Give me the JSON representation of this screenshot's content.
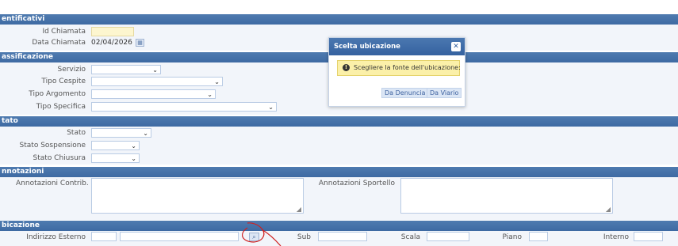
{
  "sections": {
    "identificativi": "entificativi",
    "classificazione": "assificazione",
    "stato": "tato",
    "annotazioni": "nnotazioni",
    "ubicazione": "bicazione"
  },
  "identificativi": {
    "id_chiamata_label": "Id Chiamata",
    "id_chiamata_value": "",
    "data_chiamata_label": "Data Chiamata",
    "data_chiamata_value": "02/04/2026"
  },
  "classificazione": {
    "servizio_label": "Servizio",
    "tipo_cespite_label": "Tipo Cespite",
    "tipo_argomento_label": "Tipo Argomento",
    "tipo_specifica_label": "Tipo Specifica"
  },
  "stato": {
    "stato_label": "Stato",
    "stato_sospensione_label": "Stato Sospensione",
    "stato_chiusura_label": "Stato Chiusura"
  },
  "annotazioni": {
    "contrib_label": "Annotazioni Contrib.",
    "sportello_label": "Annotazioni Sportello"
  },
  "ubicazione": {
    "indirizzo_label": "Indirizzo Esterno",
    "sub_label": "Sub",
    "scala_label": "Scala",
    "piano_label": "Piano",
    "interno_label": "Interno"
  },
  "modal": {
    "title": "Scelta ubicazione",
    "message": "Scegliere la fonte dell'ubicazione:",
    "btn_denuncia": "Da Denuncia",
    "btn_viario": "Da Viario"
  },
  "icons": {
    "select": "chevron-down-icon",
    "calendar": "calendar-icon",
    "lookup": "search-icon",
    "close": "close-icon",
    "alert": "exclamation-icon"
  },
  "colors": {
    "header_bg": "#4677b0",
    "alert_bg": "#fbf0a9",
    "annotation_red": "#d02020"
  }
}
